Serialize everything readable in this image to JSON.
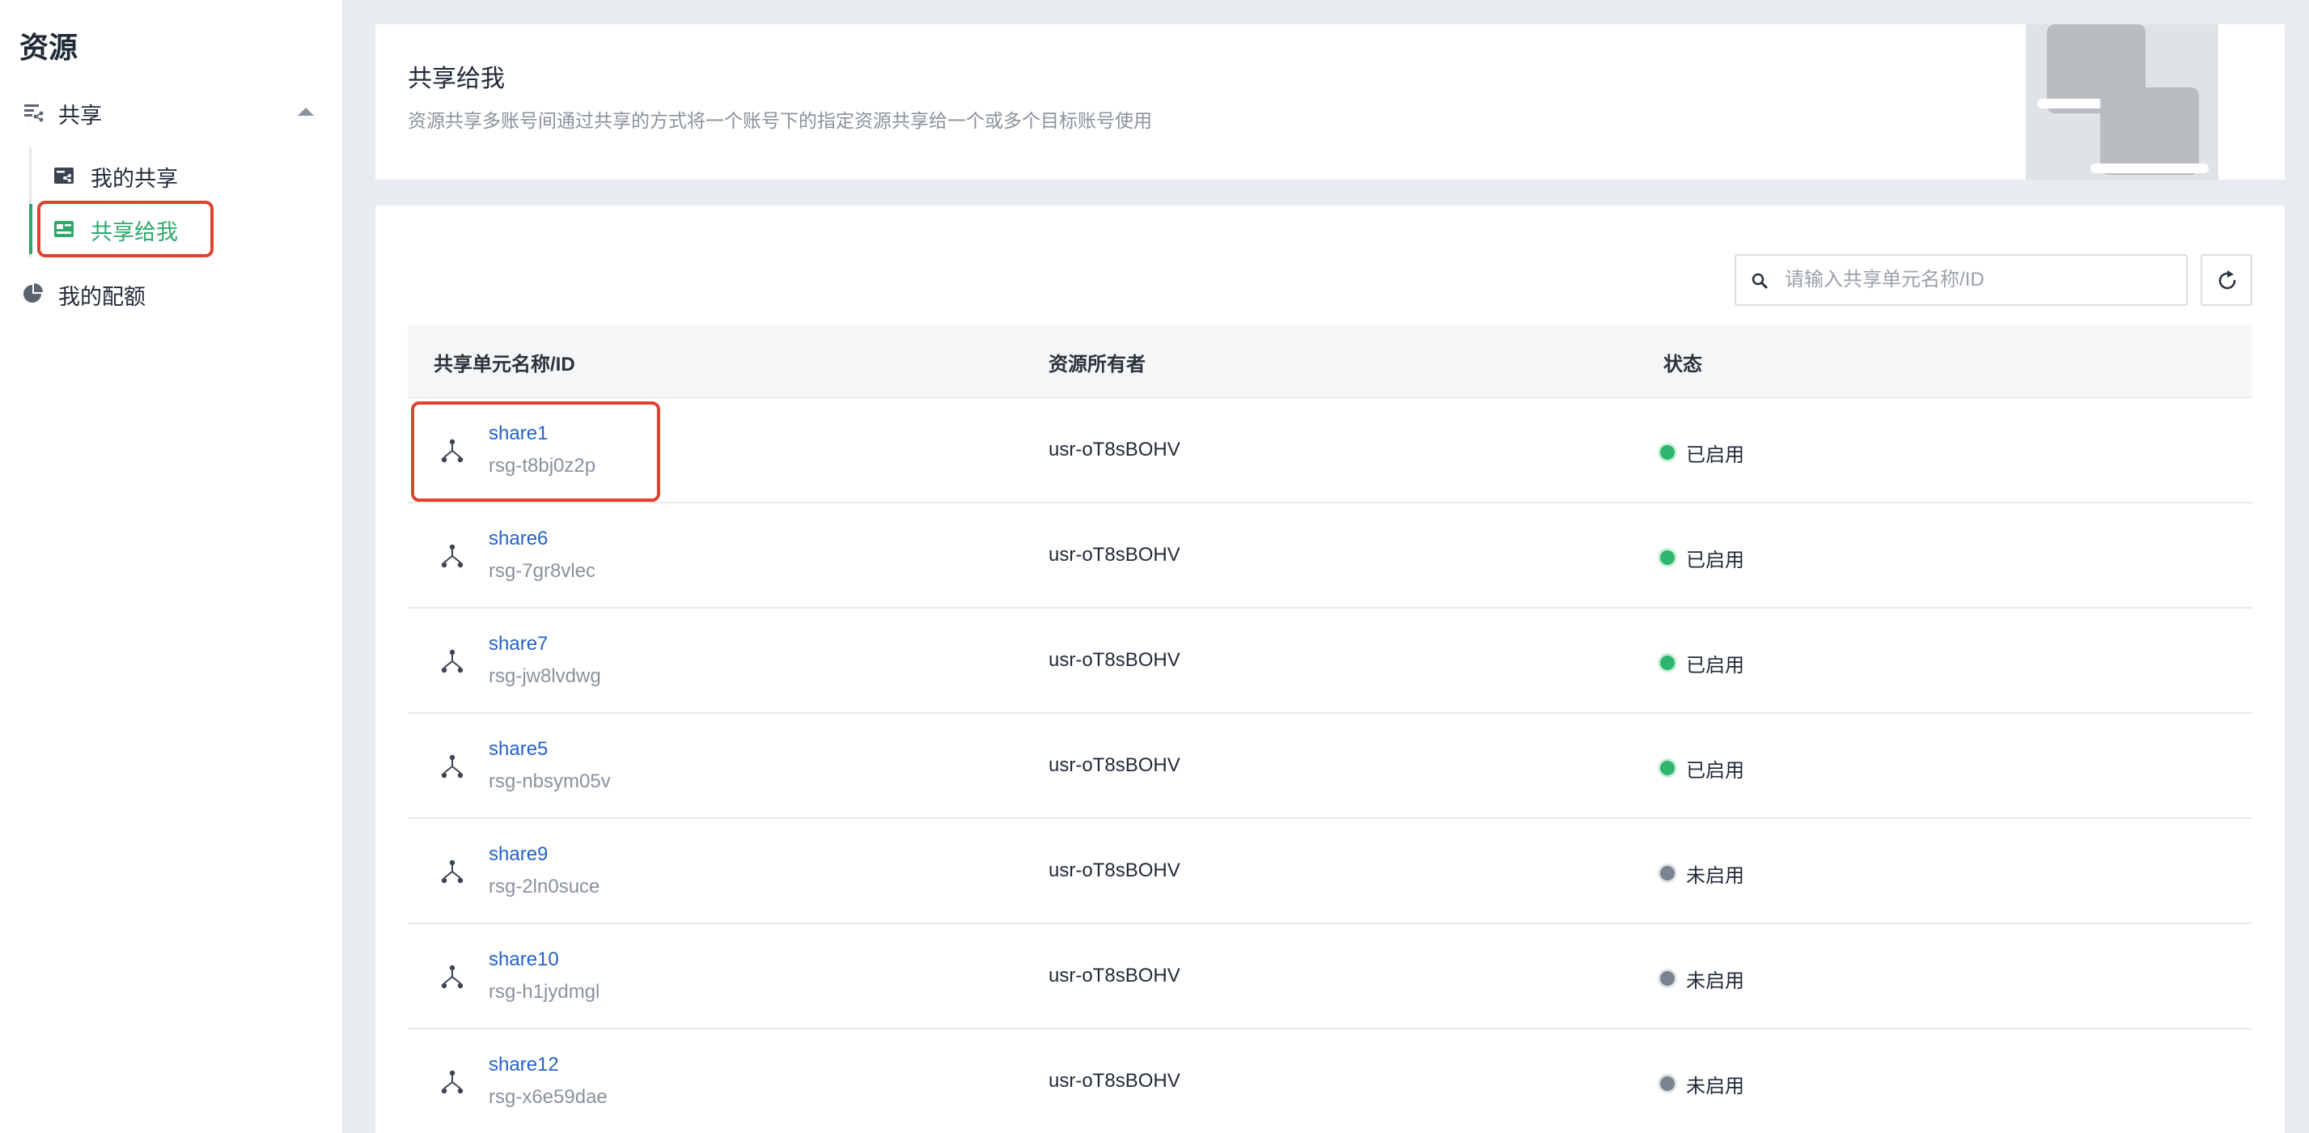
{
  "sidebar": {
    "title": "资源",
    "group": {
      "label": "共享",
      "icon": "share-icon",
      "expanded": true
    },
    "sub_items": [
      {
        "label": "我的共享",
        "icon": "my-share-icon",
        "active": false
      },
      {
        "label": "共享给我",
        "icon": "shared-to-me-icon",
        "active": true
      }
    ],
    "quota": {
      "label": "我的配额",
      "icon": "pie-chart-icon"
    }
  },
  "header": {
    "title": "共享给我",
    "description": "资源共享多账号间通过共享的方式将一个账号下的指定资源共享给一个或多个目标账号使用"
  },
  "search": {
    "placeholder": "请输入共享单元名称/ID",
    "value": ""
  },
  "table": {
    "columns": [
      "共享单元名称/ID",
      "资源所有者",
      "状态"
    ],
    "rows": [
      {
        "name": "share1",
        "id": "rsg-t8bj0z2p",
        "owner": "usr-oT8sBOHV",
        "status": "已启用",
        "enabled": true
      },
      {
        "name": "share6",
        "id": "rsg-7gr8vlec",
        "owner": "usr-oT8sBOHV",
        "status": "已启用",
        "enabled": true
      },
      {
        "name": "share7",
        "id": "rsg-jw8lvdwg",
        "owner": "usr-oT8sBOHV",
        "status": "已启用",
        "enabled": true
      },
      {
        "name": "share5",
        "id": "rsg-nbsym05v",
        "owner": "usr-oT8sBOHV",
        "status": "已启用",
        "enabled": true
      },
      {
        "name": "share9",
        "id": "rsg-2ln0suce",
        "owner": "usr-oT8sBOHV",
        "status": "未启用",
        "enabled": false
      },
      {
        "name": "share10",
        "id": "rsg-h1jydmgl",
        "owner": "usr-oT8sBOHV",
        "status": "未启用",
        "enabled": false
      },
      {
        "name": "share12",
        "id": "rsg-x6e59dae",
        "owner": "usr-oT8sBOHV",
        "status": "未启用",
        "enabled": false
      }
    ]
  },
  "colors": {
    "accent": "#2fa86c",
    "link": "#2562c9",
    "status_enabled": "#2fb66e",
    "status_disabled": "#7b838e",
    "highlight": "#e1412f"
  }
}
